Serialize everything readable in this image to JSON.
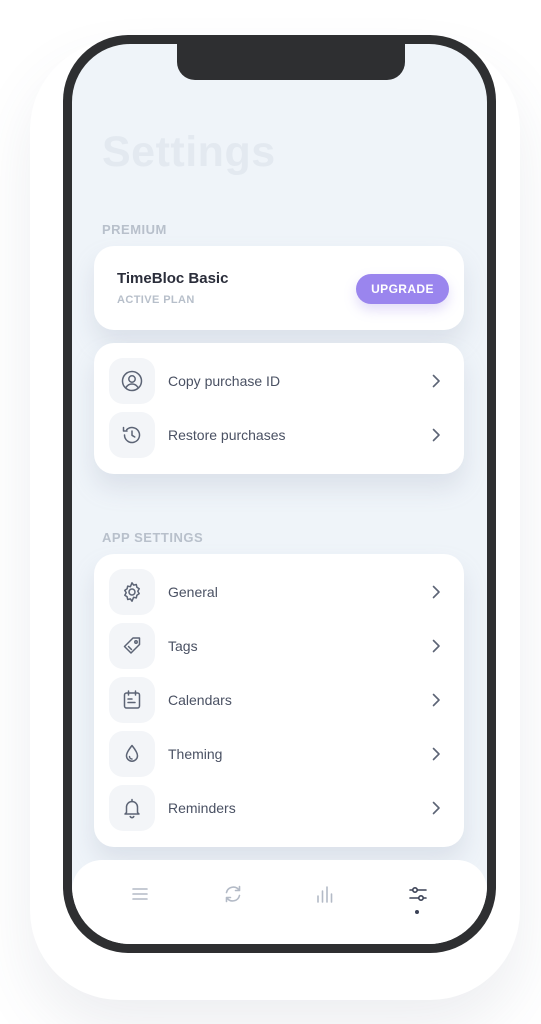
{
  "screen": {
    "title": "Settings"
  },
  "premium": {
    "section_label": "PREMIUM",
    "plan_name": "TimeBloc Basic",
    "plan_status": "ACTIVE PLAN",
    "upgrade_label": "UPGRADE",
    "items": [
      {
        "label": "Copy purchase ID",
        "icon": "user-circle-icon"
      },
      {
        "label": "Restore purchases",
        "icon": "history-icon"
      }
    ]
  },
  "app_settings": {
    "section_label": "APP SETTINGS",
    "items": [
      {
        "label": "General",
        "icon": "gear-icon"
      },
      {
        "label": "Tags",
        "icon": "tag-icon"
      },
      {
        "label": "Calendars",
        "icon": "calendar-icon"
      },
      {
        "label": "Theming",
        "icon": "droplet-icon"
      },
      {
        "label": "Reminders",
        "icon": "bell-icon"
      }
    ]
  },
  "tabbar": {
    "tabs": [
      {
        "icon": "list-icon",
        "active": false
      },
      {
        "icon": "refresh-icon",
        "active": false
      },
      {
        "icon": "bar-chart-icon",
        "active": false
      },
      {
        "icon": "sliders-icon",
        "active": true
      }
    ]
  },
  "colors": {
    "accent": "#9a85ee",
    "background": "#eff4f9",
    "frame": "#2e2f31"
  }
}
